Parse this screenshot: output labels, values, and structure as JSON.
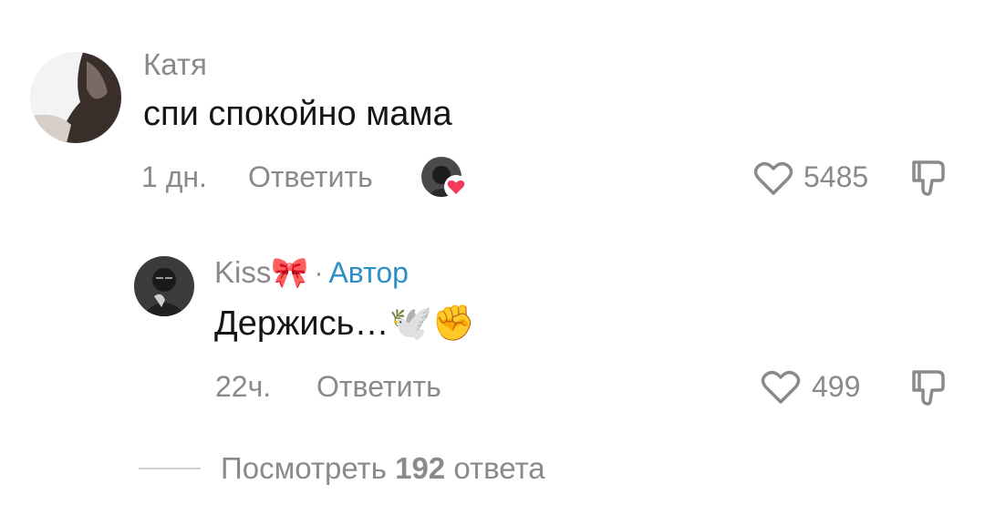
{
  "comment": {
    "author": "Катя",
    "text": "спи спокойно мама",
    "time": "1 дн.",
    "reply_label": "Ответить",
    "likes": "5485"
  },
  "reply": {
    "author": "Kiss🎀",
    "separator": "·",
    "author_badge": "Автор",
    "text": "Держись…🕊️✊",
    "time": "22ч.",
    "reply_label": "Ответить",
    "likes": "499"
  },
  "view_replies": {
    "prefix": "Посмотреть",
    "count": "192",
    "suffix": "ответа"
  },
  "colors": {
    "author_badge": "#2f8fc8",
    "muted_text": "#8a8a8a",
    "body_text": "#161616",
    "heart_badge": "#f23a5a"
  },
  "icons": {
    "like": "heart-outline-icon",
    "dislike": "thumbs-down-icon",
    "creator_liked": "creator-liked-heart-badge"
  }
}
